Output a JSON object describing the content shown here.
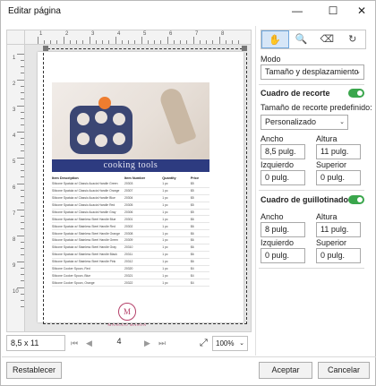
{
  "window": {
    "title": "Editar página",
    "minimize": "—",
    "maximize": "☐",
    "close": "✕"
  },
  "ruler": {
    "top_numbers": [
      "1",
      "2",
      "3",
      "4",
      "5",
      "6",
      "7",
      "8"
    ],
    "left_numbers": [
      "1",
      "2",
      "3",
      "4",
      "5",
      "6",
      "7",
      "8",
      "9",
      "10"
    ]
  },
  "document": {
    "banner": "cooking tools",
    "table_headers": [
      "Item Description",
      "Item Number",
      "Quantity",
      "Price"
    ],
    "rows": [
      [
        "Silicone Spatula w/ Classic Acacia Handle Green",
        "20303",
        "1 pc",
        "$5"
      ],
      [
        "Silicone Spatula w/ Classic Acacia Handle Orange",
        "20307",
        "1 pc",
        "$5"
      ],
      [
        "Silicone Spatula w/ Classic Acacia Handle Blue",
        "20304",
        "1 pc",
        "$5"
      ],
      [
        "Silicone Spatula w/ Classic Acacia Handle Red",
        "20305",
        "1 pc",
        "$5"
      ],
      [
        "Silicone Spatula w/ Classic Acacia Handle Gray",
        "20306",
        "1 pc",
        "$5"
      ],
      [
        "Silicone Spatula w/ Stainless Steel Handle Blue",
        "20301",
        "1 pc",
        "$6"
      ],
      [
        "Silicone Spatula w/ Stainless Steel Handle Red",
        "20302",
        "1 pc",
        "$6"
      ],
      [
        "Silicone Spatula w/ Stainless Steel Handle Orange",
        "20308",
        "1 pc",
        "$6"
      ],
      [
        "Silicone Spatula w/ Stainless Steel Handle Green",
        "20309",
        "1 pc",
        "$6"
      ],
      [
        "Silicone Spatula w/ Stainless Steel Handle Gray",
        "20310",
        "1 pc",
        "$6"
      ],
      [
        "Silicone Spatula w/ Stainless Steel Handle Black",
        "20311",
        "1 pc",
        "$6"
      ],
      [
        "Silicone Spatula w/ Stainless Steel Handle Pink",
        "20312",
        "1 pc",
        "$6"
      ],
      [
        "Silicone Cooker Spoon, Red",
        "20320",
        "1 pc",
        "$4"
      ],
      [
        "Silicone Cooker Spoon, Blue",
        "20321",
        "1 pc",
        "$4"
      ],
      [
        "Silicone Cooker Spoon, Orange",
        "20322",
        "1 pc",
        "$4"
      ]
    ],
    "logo_letter": "M",
    "logo_text": "MANOLO MASON"
  },
  "preview_bar": {
    "size": "8,5 x 11",
    "first": "⏮",
    "prev": "◀",
    "page": "4",
    "next": "▶",
    "last": "⏭",
    "fit_icon": "⤢",
    "zoom": "100%",
    "caret": "⌄"
  },
  "tools": [
    {
      "name": "hand",
      "glyph": "✋"
    },
    {
      "name": "zoom",
      "glyph": "🔍"
    },
    {
      "name": "eraser",
      "glyph": "⌫"
    },
    {
      "name": "rotate",
      "glyph": "↻"
    }
  ],
  "mode": {
    "label": "Modo",
    "value": "Tamaño y desplazamiento"
  },
  "crop": {
    "heading": "Cuadro de recorte",
    "preset_label": "Tamaño de recorte predefinido:",
    "preset_value": "Personalizado",
    "width_label": "Ancho",
    "width_value": "8,5 pulg.",
    "height_label": "Altura",
    "height_value": "11 pulg.",
    "left_label": "Izquierdo",
    "left_value": "0 pulg.",
    "top_label": "Superior",
    "top_value": "0 pulg."
  },
  "trim": {
    "heading": "Cuadro de guillotinado",
    "width_label": "Ancho",
    "width_value": "8 pulg.",
    "height_label": "Altura",
    "height_value": "11 pulg.",
    "left_label": "Izquierdo",
    "left_value": "0 pulg.",
    "top_label": "Superior",
    "top_value": "0 pulg."
  },
  "buttons": {
    "reset": "Restablecer",
    "accept": "Aceptar",
    "cancel": "Cancelar"
  },
  "colors": {
    "accent": "#1e63b8",
    "toggle_on": "#3aa64c",
    "banner": "#2d3b80",
    "logo": "#b5416a"
  }
}
